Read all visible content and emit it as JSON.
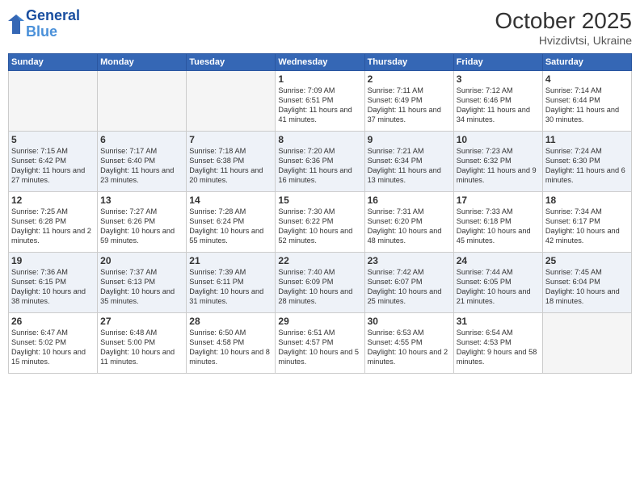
{
  "logo": {
    "line1": "General",
    "line2": "Blue"
  },
  "title": "October 2025",
  "subtitle": "Hvizdivtsi, Ukraine",
  "weekdays": [
    "Sunday",
    "Monday",
    "Tuesday",
    "Wednesday",
    "Thursday",
    "Friday",
    "Saturday"
  ],
  "weeks": [
    [
      {
        "day": "",
        "info": ""
      },
      {
        "day": "",
        "info": ""
      },
      {
        "day": "",
        "info": ""
      },
      {
        "day": "1",
        "info": "Sunrise: 7:09 AM\nSunset: 6:51 PM\nDaylight: 11 hours and 41 minutes."
      },
      {
        "day": "2",
        "info": "Sunrise: 7:11 AM\nSunset: 6:49 PM\nDaylight: 11 hours and 37 minutes."
      },
      {
        "day": "3",
        "info": "Sunrise: 7:12 AM\nSunset: 6:46 PM\nDaylight: 11 hours and 34 minutes."
      },
      {
        "day": "4",
        "info": "Sunrise: 7:14 AM\nSunset: 6:44 PM\nDaylight: 11 hours and 30 minutes."
      }
    ],
    [
      {
        "day": "5",
        "info": "Sunrise: 7:15 AM\nSunset: 6:42 PM\nDaylight: 11 hours and 27 minutes."
      },
      {
        "day": "6",
        "info": "Sunrise: 7:17 AM\nSunset: 6:40 PM\nDaylight: 11 hours and 23 minutes."
      },
      {
        "day": "7",
        "info": "Sunrise: 7:18 AM\nSunset: 6:38 PM\nDaylight: 11 hours and 20 minutes."
      },
      {
        "day": "8",
        "info": "Sunrise: 7:20 AM\nSunset: 6:36 PM\nDaylight: 11 hours and 16 minutes."
      },
      {
        "day": "9",
        "info": "Sunrise: 7:21 AM\nSunset: 6:34 PM\nDaylight: 11 hours and 13 minutes."
      },
      {
        "day": "10",
        "info": "Sunrise: 7:23 AM\nSunset: 6:32 PM\nDaylight: 11 hours and 9 minutes."
      },
      {
        "day": "11",
        "info": "Sunrise: 7:24 AM\nSunset: 6:30 PM\nDaylight: 11 hours and 6 minutes."
      }
    ],
    [
      {
        "day": "12",
        "info": "Sunrise: 7:25 AM\nSunset: 6:28 PM\nDaylight: 11 hours and 2 minutes."
      },
      {
        "day": "13",
        "info": "Sunrise: 7:27 AM\nSunset: 6:26 PM\nDaylight: 10 hours and 59 minutes."
      },
      {
        "day": "14",
        "info": "Sunrise: 7:28 AM\nSunset: 6:24 PM\nDaylight: 10 hours and 55 minutes."
      },
      {
        "day": "15",
        "info": "Sunrise: 7:30 AM\nSunset: 6:22 PM\nDaylight: 10 hours and 52 minutes."
      },
      {
        "day": "16",
        "info": "Sunrise: 7:31 AM\nSunset: 6:20 PM\nDaylight: 10 hours and 48 minutes."
      },
      {
        "day": "17",
        "info": "Sunrise: 7:33 AM\nSunset: 6:18 PM\nDaylight: 10 hours and 45 minutes."
      },
      {
        "day": "18",
        "info": "Sunrise: 7:34 AM\nSunset: 6:17 PM\nDaylight: 10 hours and 42 minutes."
      }
    ],
    [
      {
        "day": "19",
        "info": "Sunrise: 7:36 AM\nSunset: 6:15 PM\nDaylight: 10 hours and 38 minutes."
      },
      {
        "day": "20",
        "info": "Sunrise: 7:37 AM\nSunset: 6:13 PM\nDaylight: 10 hours and 35 minutes."
      },
      {
        "day": "21",
        "info": "Sunrise: 7:39 AM\nSunset: 6:11 PM\nDaylight: 10 hours and 31 minutes."
      },
      {
        "day": "22",
        "info": "Sunrise: 7:40 AM\nSunset: 6:09 PM\nDaylight: 10 hours and 28 minutes."
      },
      {
        "day": "23",
        "info": "Sunrise: 7:42 AM\nSunset: 6:07 PM\nDaylight: 10 hours and 25 minutes."
      },
      {
        "day": "24",
        "info": "Sunrise: 7:44 AM\nSunset: 6:05 PM\nDaylight: 10 hours and 21 minutes."
      },
      {
        "day": "25",
        "info": "Sunrise: 7:45 AM\nSunset: 6:04 PM\nDaylight: 10 hours and 18 minutes."
      }
    ],
    [
      {
        "day": "26",
        "info": "Sunrise: 6:47 AM\nSunset: 5:02 PM\nDaylight: 10 hours and 15 minutes."
      },
      {
        "day": "27",
        "info": "Sunrise: 6:48 AM\nSunset: 5:00 PM\nDaylight: 10 hours and 11 minutes."
      },
      {
        "day": "28",
        "info": "Sunrise: 6:50 AM\nSunset: 4:58 PM\nDaylight: 10 hours and 8 minutes."
      },
      {
        "day": "29",
        "info": "Sunrise: 6:51 AM\nSunset: 4:57 PM\nDaylight: 10 hours and 5 minutes."
      },
      {
        "day": "30",
        "info": "Sunrise: 6:53 AM\nSunset: 4:55 PM\nDaylight: 10 hours and 2 minutes."
      },
      {
        "day": "31",
        "info": "Sunrise: 6:54 AM\nSunset: 4:53 PM\nDaylight: 9 hours and 58 minutes."
      },
      {
        "day": "",
        "info": ""
      }
    ]
  ]
}
